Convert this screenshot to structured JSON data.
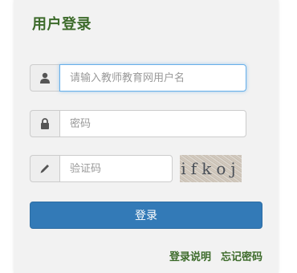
{
  "login": {
    "title": "用户登录",
    "username_placeholder": "请输入教师教育网用户名",
    "password_placeholder": "密码",
    "captcha_placeholder": "验证码",
    "captcha_text": "ifkoj",
    "submit_label": "登录",
    "help_link": "登录说明",
    "forgot_link": "忘记密码"
  },
  "icons": {
    "username": "user-icon",
    "password": "lock-icon",
    "captcha": "pencil-icon"
  },
  "colors": {
    "title": "#3d6b2b",
    "primary_button": "#337ab7",
    "focus_border": "#66afe9"
  }
}
